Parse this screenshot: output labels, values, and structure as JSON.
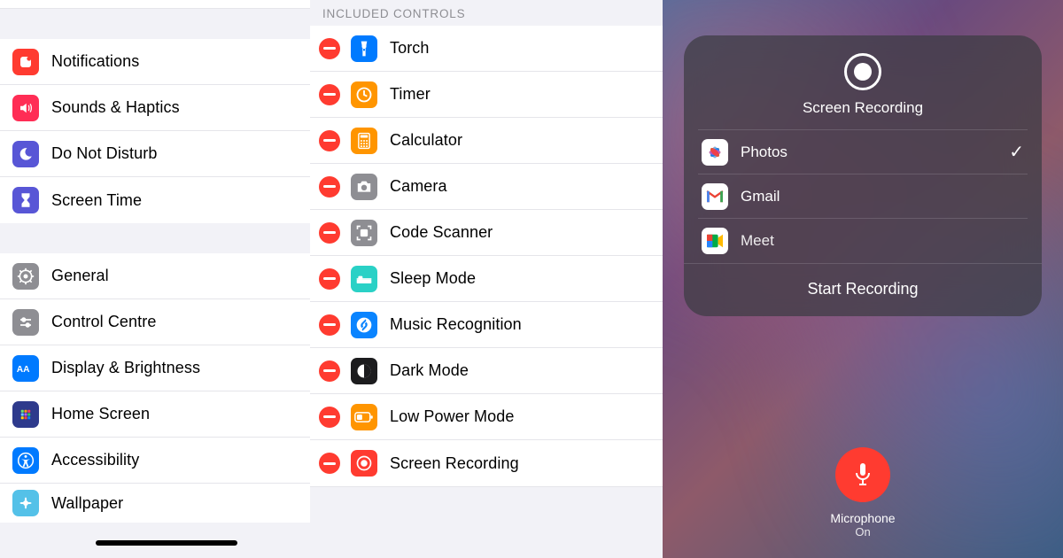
{
  "col1": {
    "group1": [
      {
        "label": "Notifications",
        "icon": "notifications",
        "bg": "#ff3b30"
      },
      {
        "label": "Sounds & Haptics",
        "icon": "sounds",
        "bg": "#ff2d55"
      },
      {
        "label": "Do Not Disturb",
        "icon": "dnd",
        "bg": "#5856d6"
      },
      {
        "label": "Screen Time",
        "icon": "screentime",
        "bg": "#5856d6"
      }
    ],
    "group2": [
      {
        "label": "General",
        "icon": "general",
        "bg": "#8e8e93"
      },
      {
        "label": "Control Centre",
        "icon": "controlcentre",
        "bg": "#8e8e93"
      },
      {
        "label": "Display & Brightness",
        "icon": "display",
        "bg": "#007aff"
      },
      {
        "label": "Home Screen",
        "icon": "homescreen",
        "bg": "#2e3a8c"
      },
      {
        "label": "Accessibility",
        "icon": "accessibility",
        "bg": "#007aff"
      },
      {
        "label": "Wallpaper",
        "icon": "wallpaper",
        "bg": "#54c1e8"
      }
    ]
  },
  "col2": {
    "header": "INCLUDED CONTROLS",
    "items": [
      {
        "label": "Torch",
        "icon": "torch",
        "bg": "#007aff"
      },
      {
        "label": "Timer",
        "icon": "timer",
        "bg": "#ff9500"
      },
      {
        "label": "Calculator",
        "icon": "calculator",
        "bg": "#ff9500"
      },
      {
        "label": "Camera",
        "icon": "camera",
        "bg": "#8e8e93"
      },
      {
        "label": "Code Scanner",
        "icon": "codescan",
        "bg": "#8e8e93"
      },
      {
        "label": "Sleep Mode",
        "icon": "sleep",
        "bg": "#2ad1c6"
      },
      {
        "label": "Music Recognition",
        "icon": "music",
        "bg": "#0a84ff"
      },
      {
        "label": "Dark Mode",
        "icon": "darkmode",
        "bg": "#1c1c1e"
      },
      {
        "label": "Low Power Mode",
        "icon": "lowpower",
        "bg": "#ff9500"
      },
      {
        "label": "Screen Recording",
        "icon": "record",
        "bg": "#ff3b30"
      }
    ]
  },
  "col3": {
    "title": "Screen Recording",
    "apps": [
      {
        "name": "Photos",
        "icon": "photos",
        "selected": true
      },
      {
        "name": "Gmail",
        "icon": "gmail",
        "selected": false
      },
      {
        "name": "Meet",
        "icon": "meet",
        "selected": false
      }
    ],
    "start_label": "Start Recording",
    "mic_label": "Microphone",
    "mic_state": "On"
  }
}
